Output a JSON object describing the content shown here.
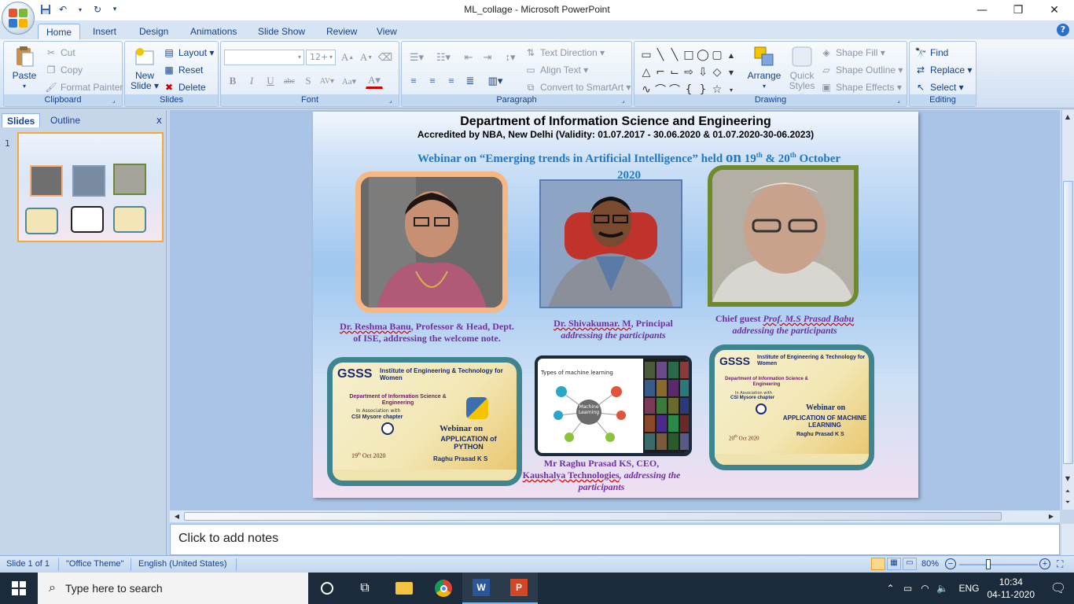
{
  "window": {
    "title": "ML_collage - Microsoft PowerPoint",
    "minimize": "—",
    "maximize": "❐",
    "close": "✕"
  },
  "tabs": [
    "Home",
    "Insert",
    "Design",
    "Animations",
    "Slide Show",
    "Review",
    "View"
  ],
  "ribbon": {
    "clipboard": {
      "label": "Clipboard",
      "paste": "Paste",
      "cut": "Cut",
      "copy": "Copy",
      "format_painter": "Format Painter"
    },
    "slides": {
      "label": "Slides",
      "new_slide_1": "New",
      "new_slide_2": "Slide ▾",
      "layout": "Layout ▾",
      "reset": "Reset",
      "delete": "Delete"
    },
    "font": {
      "label": "Font",
      "font_size": "12+"
    },
    "paragraph": {
      "label": "Paragraph",
      "text_direction": "Text Direction ▾",
      "align_text": "Align Text ▾",
      "convert_smartart": "Convert to SmartArt ▾"
    },
    "drawing": {
      "label": "Drawing",
      "arrange": "Arrange",
      "quick_styles_1": "Quick",
      "quick_styles_2": "Styles ▾",
      "shape_fill": "Shape Fill ▾",
      "shape_outline": "Shape Outline ▾",
      "shape_effects": "Shape Effects ▾"
    },
    "editing": {
      "label": "Editing",
      "find": "Find",
      "replace": "Replace ▾",
      "select": "Select ▾"
    }
  },
  "left_pane": {
    "tab_slides": "Slides",
    "tab_outline": "Outline",
    "close": "x",
    "slide_number": "1"
  },
  "slide": {
    "heading": "Department of Information Science and Engineering",
    "accreditation": "Accredited by NBA, New Delhi  (Validity: 01.07.2017 - 30.06.2020 & 01.07.2020-30-06.2023)",
    "webinar_prefix": "Webinar on “Emerging trends in Artificial Intelligence” held ",
    "webinar_on": "on",
    "webinar_d1": " 19",
    "webinar_sup1": "th",
    "webinar_amp": " & 20",
    "webinar_sup2": "th",
    "webinar_month": " October",
    "webinar_year": "2020",
    "caption1_name": "Dr. Reshma Banu",
    "caption1_rest": ", Professor & Head, Dept. of ISE, addressing the welcome note.",
    "caption2_name": "Dr. Shivakumar. M",
    "caption2_role": ", Principal",
    "caption2_line2": "addressing the participants",
    "caption3_pre": "Chief guest ",
    "caption3_name": "Prof. M.S Prasad Babu",
    "caption3_line2": "addressing the participants",
    "caption4_line1": "Mr Raghu Prasad KS, CEO,",
    "caption4_company": "Kaushalya Technologies",
    "caption4_rest": ", addressing the participants",
    "poster1": {
      "brand": "GSSS",
      "inst": "Institute of Engineering & Technology for Women",
      "dept": "Department of Information Science & Engineering",
      "assoc": "In Association with",
      "csi": "CSI Mysore chapter",
      "webinar": "Webinar on",
      "topic": "APPLICATION of PYTHON",
      "presenter": "Raghu Prasad K S",
      "date": "19",
      "date_sup": "th",
      "date_rest": " Oct 2020"
    },
    "poster2": {
      "brand": "GSSS",
      "inst": "Institute of Engineering & Technology for Women",
      "dept": "Department of Information Science & Engineering",
      "assoc": "In Association with",
      "csi": "CSI Mysore chapter",
      "webinar": "Webinar on",
      "topic": "APPLICATION OF MACHINE LEARNING",
      "presenter": "Raghu Prasad K S",
      "date": "20",
      "date_sup": "th",
      "date_rest": " Oct 2020"
    },
    "screen": {
      "title": "Types of  machine learning",
      "center": "Machine Learning"
    }
  },
  "notes": {
    "placeholder": "Click to add notes"
  },
  "status": {
    "slide_of": "Slide 1 of 1",
    "theme": "\"Office Theme\"",
    "language": "English (United States)",
    "zoom": "80%"
  },
  "taskbar": {
    "search_placeholder": "Type here to search",
    "language": "ENG",
    "time": "10:34",
    "date": "04-11-2020"
  },
  "colors": {
    "ribbon_text": "#15428b",
    "slide_heading": "#000000",
    "webinar_title": "#1f78c8",
    "caption": "#7030a0",
    "taskbar": "#1b2b3c"
  }
}
